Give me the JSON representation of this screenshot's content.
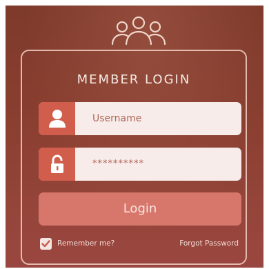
{
  "header": {
    "icon": "people-group-icon"
  },
  "form": {
    "title": "MEMBER LOGIN",
    "username": {
      "placeholder": "Username",
      "icon": "user-icon"
    },
    "password": {
      "value": "**********",
      "icon": "lock-icon"
    },
    "login_label": "Login",
    "remember_label": "Remember me?",
    "remember_checked": true,
    "forgot_label": "Forgot Password"
  },
  "colors": {
    "background": "#8a3f30",
    "accent": "#d15e4c",
    "button": "#d7766a",
    "field_bg": "#f7ece9"
  }
}
